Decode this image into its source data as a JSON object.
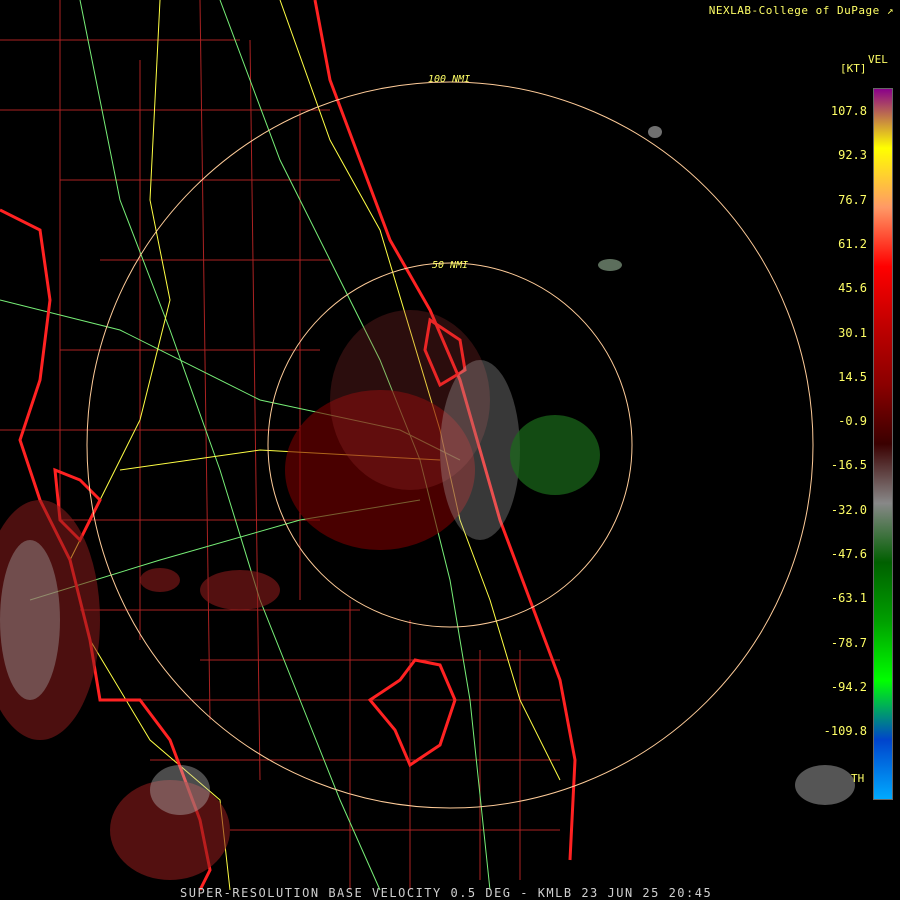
{
  "header": {
    "source_label": "NEXLAB-College of DuPage"
  },
  "range_rings": [
    {
      "label": "100 NMI"
    },
    {
      "label": "50 NMI"
    }
  ],
  "legend": {
    "product": "VEL",
    "unit": "[KT]",
    "bottom_label": "TH",
    "values": [
      "107.8",
      "92.3",
      "76.7",
      "61.2",
      "45.6",
      "30.1",
      "14.5",
      "-0.9",
      "-16.5",
      "-32.0",
      "-47.6",
      "-63.1",
      "-78.7",
      "-94.2",
      "-109.8"
    ],
    "colors": [
      "#8a008a",
      "#ffff00",
      "#ff9966",
      "#ff0000",
      "#c00000",
      "#8b0000",
      "#3a0000",
      "#888888",
      "#006000",
      "#00a000",
      "#00ff00",
      "#0044cc",
      "#00aaff"
    ]
  },
  "footer": {
    "text": "SUPER-RESOLUTION BASE VELOCITY 0.5 DEG - KMLB 23 JUN 25 20:45"
  },
  "colors": {
    "coast": "#ff2222",
    "county": "#aa2222",
    "roads": "#77ee77",
    "highway": "#ffff44",
    "ring": "#ffcc99"
  }
}
